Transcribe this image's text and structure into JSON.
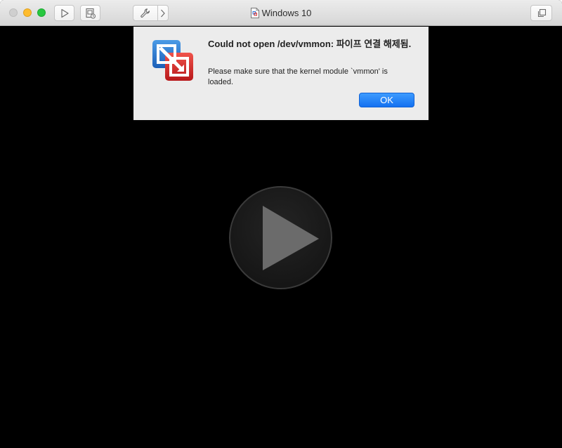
{
  "window": {
    "title": "Windows 10",
    "title_icon": "vmx-document-icon"
  },
  "toolbar": {
    "play_icon": "play-icon",
    "snapshot_icon": "snapshot-icon",
    "settings_icon": "wrench-icon",
    "more_icon": "chevron-right-icon",
    "fullscreen_icon": "fullscreen-icon"
  },
  "dialog": {
    "title": "Could not open /dev/vmmon: 파이프 연결 해제됨.",
    "message": "Please make sure that the kernel module `vmmon' is loaded.",
    "ok_label": "OK",
    "icon": "vmware-fusion-logo"
  },
  "colors": {
    "accent": "#1a76f2",
    "vm_background": "#000000",
    "dialog_background": "#ececec"
  }
}
